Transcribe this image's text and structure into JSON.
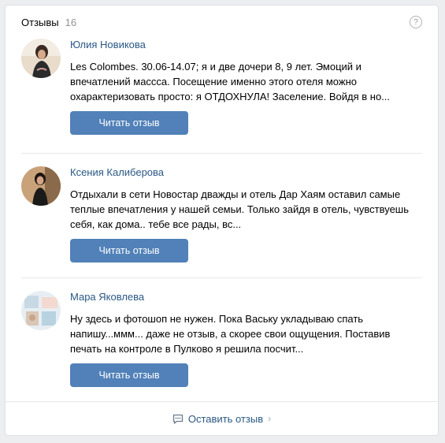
{
  "header": {
    "title": "Отзывы",
    "count": "16",
    "help_icon": "question-icon"
  },
  "reviews": [
    {
      "author": "Юлия Новикова",
      "text": "Les Colombes. 30.06-14.07; я и две дочери 8, 9 лет. Эмоций и впечатлений массса. Посещение именно этого отеля можно охарактеризовать просто: я ОТДОХНУЛА! Заселение. Войдя в но...",
      "button": "Читать отзыв"
    },
    {
      "author": "Ксения Калиберова",
      "text": "Отдыхали в сети Новостар дважды и отель Дар Хаям оставил самые теплые впечатления у нашей семьи. Только зайдя в отель, чувствуешь себя, как дома.. тебе все рады, вс...",
      "button": "Читать отзыв"
    },
    {
      "author": "Мара Яковлева",
      "text": "Ну здесь и фотошоп не нужен. Пока Ваську укладываю спать напишу...ммм... даже не отзыв, а скорее свои ощущения. Поставив печать на контроле в Пулково я решила посчит...",
      "button": "Читать отзыв"
    }
  ],
  "footer": {
    "label": "Оставить отзыв",
    "icon": "comment-icon"
  },
  "colors": {
    "accent": "#5181b8",
    "link": "#2a5885",
    "background": "#edeef0"
  }
}
